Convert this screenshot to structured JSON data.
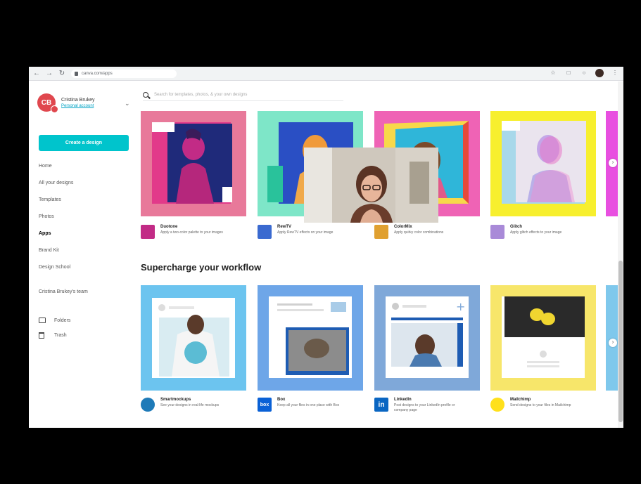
{
  "browser": {
    "url": "canva.com/apps",
    "back_icon": "arrow-left",
    "forward_icon": "arrow-right",
    "reload_icon": "reload"
  },
  "account": {
    "initials": "CB",
    "name": "Cristina Brukey",
    "link": "Personal account"
  },
  "sidebar": {
    "create_label": "Create a design",
    "items": [
      {
        "label": "Home",
        "active": false
      },
      {
        "label": "All your designs",
        "active": false
      },
      {
        "label": "Templates",
        "active": false
      },
      {
        "label": "Photos",
        "active": false
      },
      {
        "label": "Apps",
        "active": true
      },
      {
        "label": "Brand Kit",
        "active": false
      },
      {
        "label": "Design School",
        "active": false
      }
    ],
    "team": "Cristina Brukey's team",
    "folders_label": "Folders",
    "trash_label": "Trash"
  },
  "search": {
    "placeholder": "Search for templates, photos, & your own designs"
  },
  "section_title": "Supercharge your workflow",
  "row1_apps": [
    {
      "name": "Duotone",
      "desc": "Apply a two-color palette to your images",
      "color": "#e8799a"
    },
    {
      "name": "RewTV",
      "desc": "Apply RewTV effects on your image",
      "color": "#7ee6c8"
    },
    {
      "name": "ColorMix",
      "desc": "Apply quirky color combinations",
      "color": "#ef63b5"
    },
    {
      "name": "Glitch",
      "desc": "Apply glitch effects to your image",
      "color": "#f7ef2e"
    }
  ],
  "row2_apps": [
    {
      "name": "Smartmockups",
      "desc": "See your designs in real-life mockups",
      "color": "#6cc4ef"
    },
    {
      "name": "Box",
      "desc": "Keep all your files in one place with Box",
      "color": "#6ea6e8",
      "logo": "box"
    },
    {
      "name": "LinkedIn",
      "desc": "Post designs to your LinkedIn profile or company page",
      "color": "#7fa8d9",
      "logo": "in"
    },
    {
      "name": "Mailchimp",
      "desc": "Send designs to your files in Mailchimp",
      "color": "#f7e66a"
    }
  ]
}
